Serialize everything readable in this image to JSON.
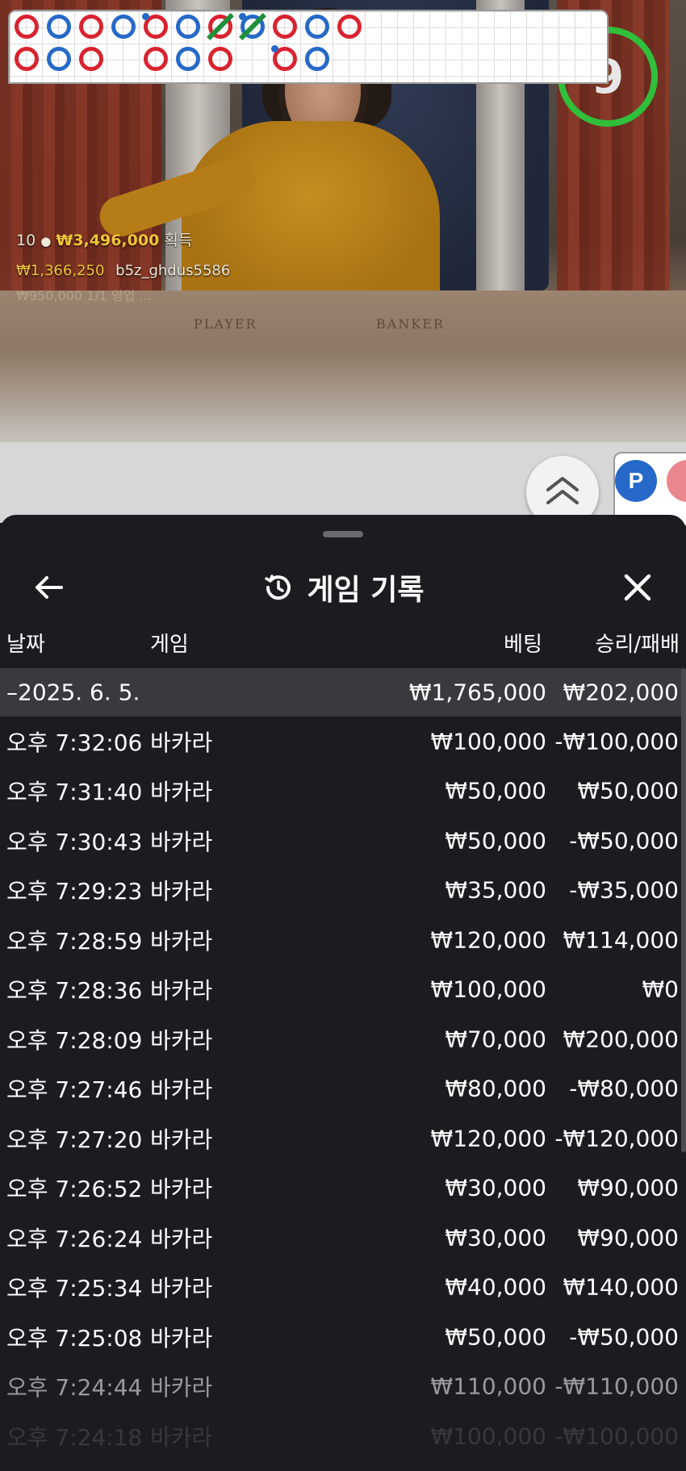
{
  "video": {
    "timer": "9",
    "table_left_label": "PLAYER",
    "table_right_label": "BANKER",
    "winners": {
      "count": "10",
      "amount": "₩3,496,000",
      "suffix": "획득",
      "top_amount": "₩1,366,250",
      "top_user": "b5z_ghdus5586",
      "faded_line": "₩950,000 1/1 영업 ..."
    }
  },
  "roadmap": {
    "badge_player": "P"
  },
  "history": {
    "title": "게임 기록",
    "columns": {
      "date": "날짜",
      "game": "게임",
      "bet": "베팅",
      "win_loss": "승리/패배"
    },
    "date_group": {
      "label": "–2025. 6. 5.",
      "bet": "₩1,765,000",
      "win_loss": "₩202,000"
    },
    "rows": [
      {
        "time": "오후 7:32:06",
        "game": "바카라",
        "bet": "₩100,000",
        "win_loss": "-₩100,000"
      },
      {
        "time": "오후 7:31:40",
        "game": "바카라",
        "bet": "₩50,000",
        "win_loss": "₩50,000"
      },
      {
        "time": "오후 7:30:43",
        "game": "바카라",
        "bet": "₩50,000",
        "win_loss": "-₩50,000"
      },
      {
        "time": "오후 7:29:23",
        "game": "바카라",
        "bet": "₩35,000",
        "win_loss": "-₩35,000"
      },
      {
        "time": "오후 7:28:59",
        "game": "바카라",
        "bet": "₩120,000",
        "win_loss": "₩114,000"
      },
      {
        "time": "오후 7:28:36",
        "game": "바카라",
        "bet": "₩100,000",
        "win_loss": "₩0"
      },
      {
        "time": "오후 7:28:09",
        "game": "바카라",
        "bet": "₩70,000",
        "win_loss": "₩200,000"
      },
      {
        "time": "오후 7:27:46",
        "game": "바카라",
        "bet": "₩80,000",
        "win_loss": "-₩80,000"
      },
      {
        "time": "오후 7:27:20",
        "game": "바카라",
        "bet": "₩120,000",
        "win_loss": "-₩120,000"
      },
      {
        "time": "오후 7:26:52",
        "game": "바카라",
        "bet": "₩30,000",
        "win_loss": "₩90,000"
      },
      {
        "time": "오후 7:26:24",
        "game": "바카라",
        "bet": "₩30,000",
        "win_loss": "₩90,000"
      },
      {
        "time": "오후 7:25:34",
        "game": "바카라",
        "bet": "₩40,000",
        "win_loss": "₩140,000"
      },
      {
        "time": "오후 7:25:08",
        "game": "바카라",
        "bet": "₩50,000",
        "win_loss": "-₩50,000"
      },
      {
        "time": "오후 7:24:44",
        "game": "바카라",
        "bet": "₩110,000",
        "win_loss": "-₩110,000"
      },
      {
        "time": "오후 7:24:18",
        "game": "바카라",
        "bet": "₩100,000",
        "win_loss": "-₩100,000"
      }
    ]
  },
  "icons": [
    "back-arrow-icon",
    "history-icon",
    "close-icon",
    "chevron-up-icon"
  ]
}
